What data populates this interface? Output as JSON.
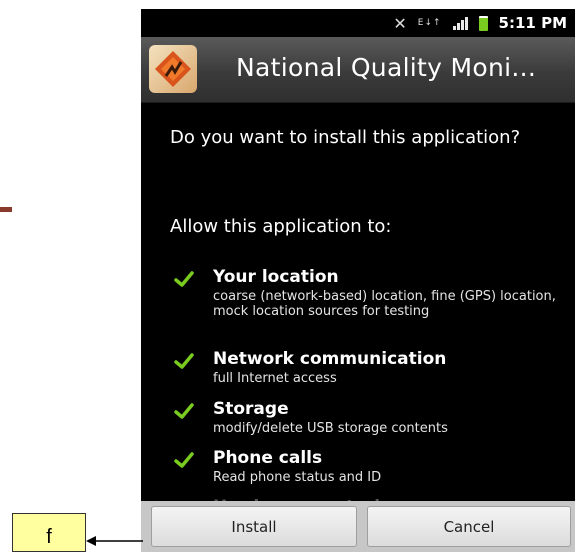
{
  "status_bar": {
    "time": "5:11 PM",
    "network_type": "E",
    "icons": [
      "mute-icon",
      "data-arrows-icon",
      "signal-icon",
      "battery-icon"
    ]
  },
  "title_bar": {
    "app_title": "National Quality Moni...",
    "app_icon": "app-logo-icon"
  },
  "install_prompt": {
    "question": "Do you want to install this application?",
    "allow_heading": "Allow this application to:",
    "permissions": [
      {
        "title": "Your location",
        "description": "coarse (network-based) location, fine (GPS) location, mock location sources for testing"
      },
      {
        "title": "Network communication",
        "description": "full Internet access"
      },
      {
        "title": "Storage",
        "description": "modify/delete USB storage contents"
      },
      {
        "title": "Phone calls",
        "description": "Read phone status and ID"
      },
      {
        "title": "Hardware controls",
        "description": ""
      }
    ]
  },
  "buttons": {
    "install_label": "Install",
    "cancel_label": "Cancel"
  },
  "annotation": {
    "callout_label": "f"
  },
  "colors": {
    "check_green": "#7acb1f",
    "callout_fill": "#ffffa0",
    "battery": "#7acb1f"
  }
}
